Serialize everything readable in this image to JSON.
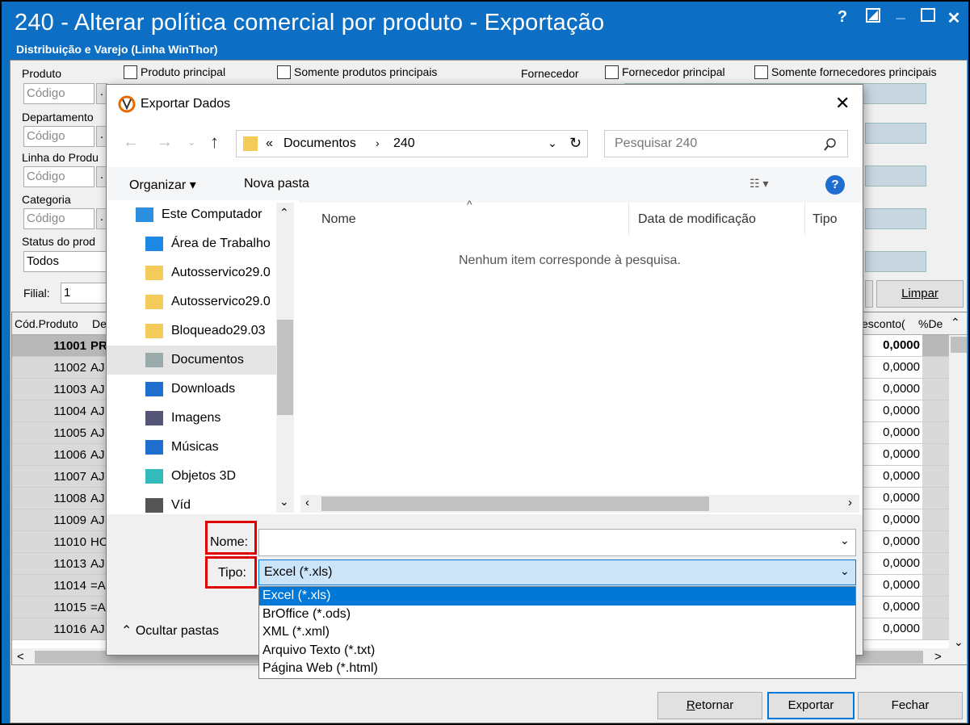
{
  "app": {
    "title": "240 - Alterar política comercial por produto - Exportação",
    "subtitle": "Distribuição e Varejo (Linha WinThor)",
    "win_help": "?",
    "win_close": "✕"
  },
  "filters": {
    "produto_label": "Produto",
    "produto_principal": "Produto principal",
    "somente_principais": "Somente produtos principais",
    "fornecedor_label": "Fornecedor",
    "fornecedor_principal": "Fornecedor principal",
    "somente_fornecedores": "Somente fornecedores principais",
    "departamento_label": "Departamento",
    "linha_label": "Linha do Produ",
    "categoria_label": "Categoria",
    "status_label": "Status do prod",
    "status_value": "Todos",
    "codigo_placeholder": "Código",
    "filial_label": "Filial:",
    "filial_value": "1",
    "limpar": "Limpar"
  },
  "grid": {
    "col_codigo": "Cód.Produto",
    "col_desc": "De",
    "col_desconto": "esconto(",
    "col_pdesc": "%De",
    "rows": [
      {
        "code": "11001",
        "desc": "PR",
        "val": "0,0000",
        "bold": true
      },
      {
        "code": "11002",
        "desc": "AJ",
        "val": "0,0000"
      },
      {
        "code": "11003",
        "desc": "AJ",
        "val": "0,0000"
      },
      {
        "code": "11004",
        "desc": "AJ",
        "val": "0,0000"
      },
      {
        "code": "11005",
        "desc": "AJ",
        "val": "0,0000"
      },
      {
        "code": "11006",
        "desc": "AJ",
        "val": "0,0000"
      },
      {
        "code": "11007",
        "desc": "AJ",
        "val": "0,0000"
      },
      {
        "code": "11008",
        "desc": "AJ",
        "val": "0,0000"
      },
      {
        "code": "11009",
        "desc": "AJ",
        "val": "0,0000"
      },
      {
        "code": "11010",
        "desc": "HO",
        "val": "0,0000"
      },
      {
        "code": "11013",
        "desc": "AJ",
        "val": "0,0000"
      },
      {
        "code": "11014",
        "desc": "=A",
        "val": "0,0000"
      },
      {
        "code": "11015",
        "desc": "=A",
        "val": "0,0000"
      },
      {
        "code": "11016",
        "desc": "AJ",
        "val": "0,0000"
      }
    ]
  },
  "bottom": {
    "retornar": "Retornar",
    "exportar": "Exportar",
    "fechar": "Fechar"
  },
  "dialog": {
    "title": "Exportar Dados",
    "breadcrumb_prefix": "«",
    "crumb1": "Documentos",
    "crumb2": "240",
    "search_placeholder": "Pesquisar 240",
    "organizar": "Organizar",
    "nova_pasta": "Nova pasta",
    "col_nome": "Nome",
    "col_data": "Data de modificação",
    "col_tipo": "Tipo",
    "empty": "Nenhum item corresponde à pesquisa.",
    "nav": [
      {
        "label": "Este Computador",
        "icon": "computer-icon"
      },
      {
        "label": "Área de Trabalho",
        "icon": "desktop-icon"
      },
      {
        "label": "Autosservico29.0",
        "icon": "folder-icon"
      },
      {
        "label": "Autosservico29.0",
        "icon": "folder-icon"
      },
      {
        "label": "Bloqueado29.03",
        "icon": "folder-icon"
      },
      {
        "label": "Documentos",
        "icon": "documents-icon"
      },
      {
        "label": "Downloads",
        "icon": "downloads-icon"
      },
      {
        "label": "Imagens",
        "icon": "images-icon"
      },
      {
        "label": "Músicas",
        "icon": "music-icon"
      },
      {
        "label": "Objetos 3D",
        "icon": "objects3d-icon"
      },
      {
        "label": "Víd",
        "icon": "videos-icon"
      }
    ],
    "nome_label": "Nome:",
    "nome_value": "",
    "tipo_label": "Tipo:",
    "tipo_value": "Excel (*.xls)",
    "ocultar": "Ocultar pastas",
    "options": [
      "Excel (*.xls)",
      "BrOffice (*.ods)",
      "XML (*.xml)",
      "Arquivo Texto (*.txt)",
      "Página Web (*.html)"
    ]
  }
}
